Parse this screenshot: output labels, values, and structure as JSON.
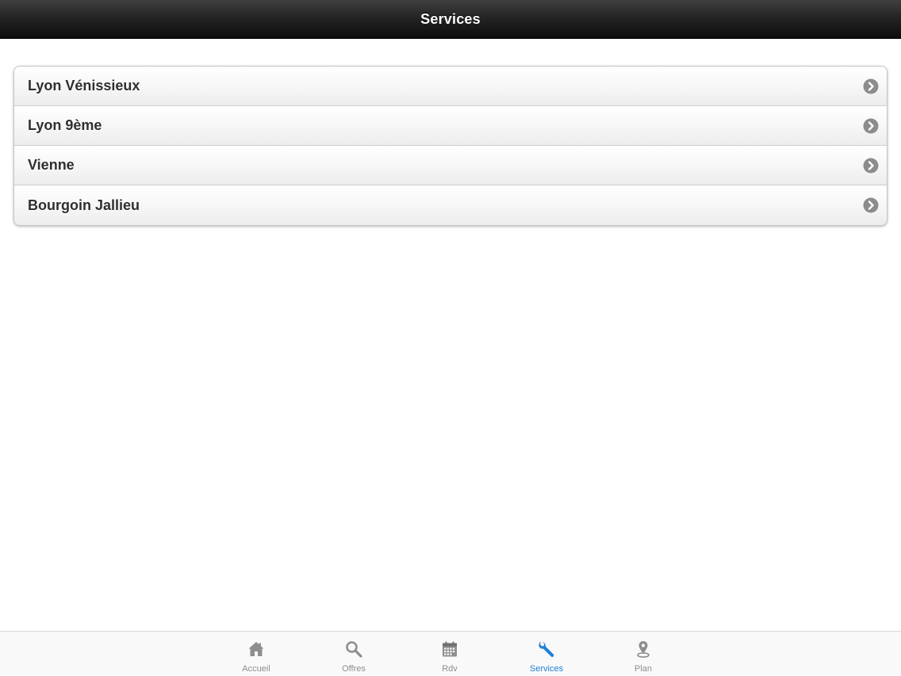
{
  "header": {
    "title": "Services"
  },
  "services": {
    "items": [
      {
        "label": "Lyon Vénissieux"
      },
      {
        "label": "Lyon 9ème"
      },
      {
        "label": "Vienne"
      },
      {
        "label": "Bourgoin Jallieu"
      }
    ]
  },
  "tabbar": {
    "active_color": "#1f7fd9",
    "inactive_color": "#8e8e8e",
    "tabs": [
      {
        "label": "Accueil",
        "icon": "home-icon"
      },
      {
        "label": "Offres",
        "icon": "search-icon"
      },
      {
        "label": "Rdv",
        "icon": "calendar-icon"
      },
      {
        "label": "Services",
        "icon": "wrench-icon",
        "active": true
      },
      {
        "label": "Plan",
        "icon": "map-pin-icon"
      }
    ]
  }
}
